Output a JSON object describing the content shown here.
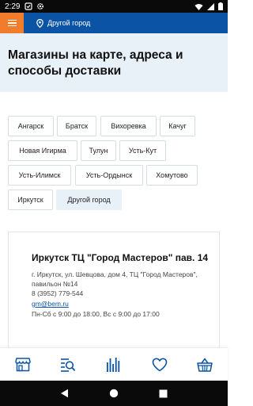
{
  "status_bar": {
    "time": "2:29"
  },
  "app_bar": {
    "city": "Другой город"
  },
  "header": {
    "title": "Магазины на карте, адреса и способы доставки"
  },
  "cities": [
    {
      "label": "Ангарск",
      "active": false
    },
    {
      "label": "Братск",
      "active": false
    },
    {
      "label": "Вихоревка",
      "active": false
    },
    {
      "label": "Качуг",
      "active": false
    },
    {
      "label": "Новая Игирма",
      "active": false
    },
    {
      "label": "Тулун",
      "active": false
    },
    {
      "label": "Усть-Кут",
      "active": false
    },
    {
      "label": "Усть-Илимск",
      "active": false
    },
    {
      "label": "Усть-Ордынск",
      "active": false
    },
    {
      "label": "Хомутово",
      "active": false
    },
    {
      "label": "Иркутск",
      "active": false
    },
    {
      "label": "Другой город",
      "active": true
    }
  ],
  "store": {
    "name": "Иркутск ТЦ \"Город Мастеров\" пав. 14",
    "address": "г. Иркутск, ул. Шевцова, дом 4, ТЦ \"Город Мастеров\", павильон №14",
    "phone": "8 (3952) 779-544",
    "email": "gm@bem.ru",
    "hours": "Пн-Сб с 9:00 до 18:00, Вс с 9:00 до 17:00"
  },
  "bottom_nav": [
    {
      "icon": "store-icon"
    },
    {
      "icon": "catalog-search-icon"
    },
    {
      "icon": "barcode-icon"
    },
    {
      "icon": "heart-icon"
    },
    {
      "icon": "basket-icon"
    }
  ],
  "colors": {
    "primary": "#0b54a5",
    "accent": "#f07c2c",
    "panel": "#e8f0f8"
  }
}
